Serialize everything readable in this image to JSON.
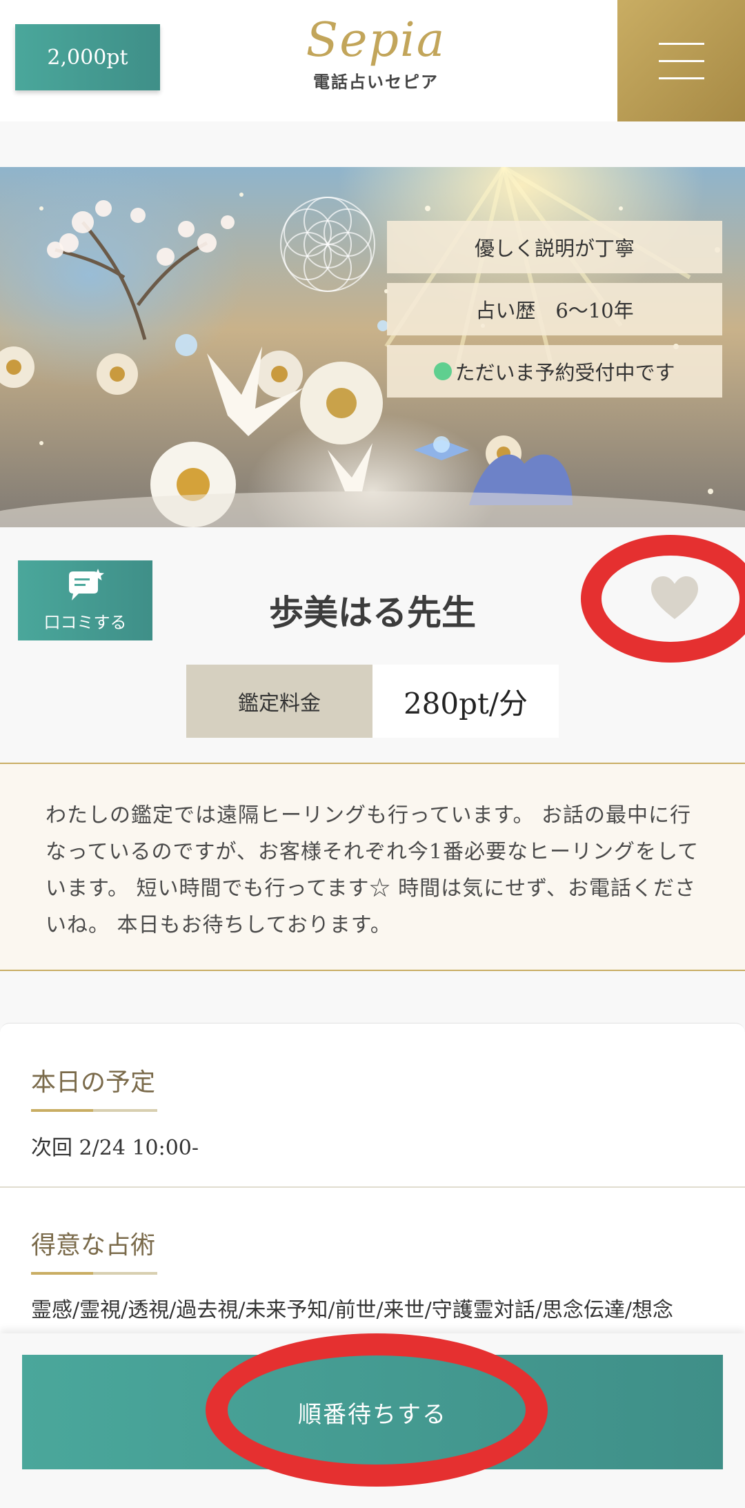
{
  "header": {
    "points": "2,000pt",
    "logo_script": "Sepia",
    "logo_subtitle": "電話占いセピア"
  },
  "hero": {
    "tags": [
      "優しく説明が丁寧",
      "占い歴　6〜10年",
      "ただいま予約受付中です"
    ],
    "status_color": "#5fcf8f"
  },
  "profile": {
    "review_button": "口コミする",
    "name": "歩美はる先生",
    "fee_label": "鑑定料金",
    "fee_value": "280pt/分",
    "favorite_icon": "heart-icon",
    "favorite_color": "#d9d4ca"
  },
  "intro": {
    "text": "わたしの鑑定では遠隔ヒーリングも行っています。 お話の最中に行なっているのですが、お客様それぞれ今1番必要なヒーリングをしています。 短い時間でも行ってます☆ 時間は気にせず、お電話くださいね。 本日もお待ちしております。"
  },
  "schedule": {
    "title": "本日の予定",
    "next": "次回 2/24 10:00-"
  },
  "skills": {
    "title": "得意な占術",
    "text": "霊感/霊視/透視/過去視/未来予知/前世/来世/守護霊対話/思念伝達/想念"
  },
  "cta": {
    "queue_button": "順番待ちする"
  },
  "colors": {
    "teal": "#4aa79b",
    "gold": "#c9ad63",
    "annotation_red": "#e53030"
  }
}
